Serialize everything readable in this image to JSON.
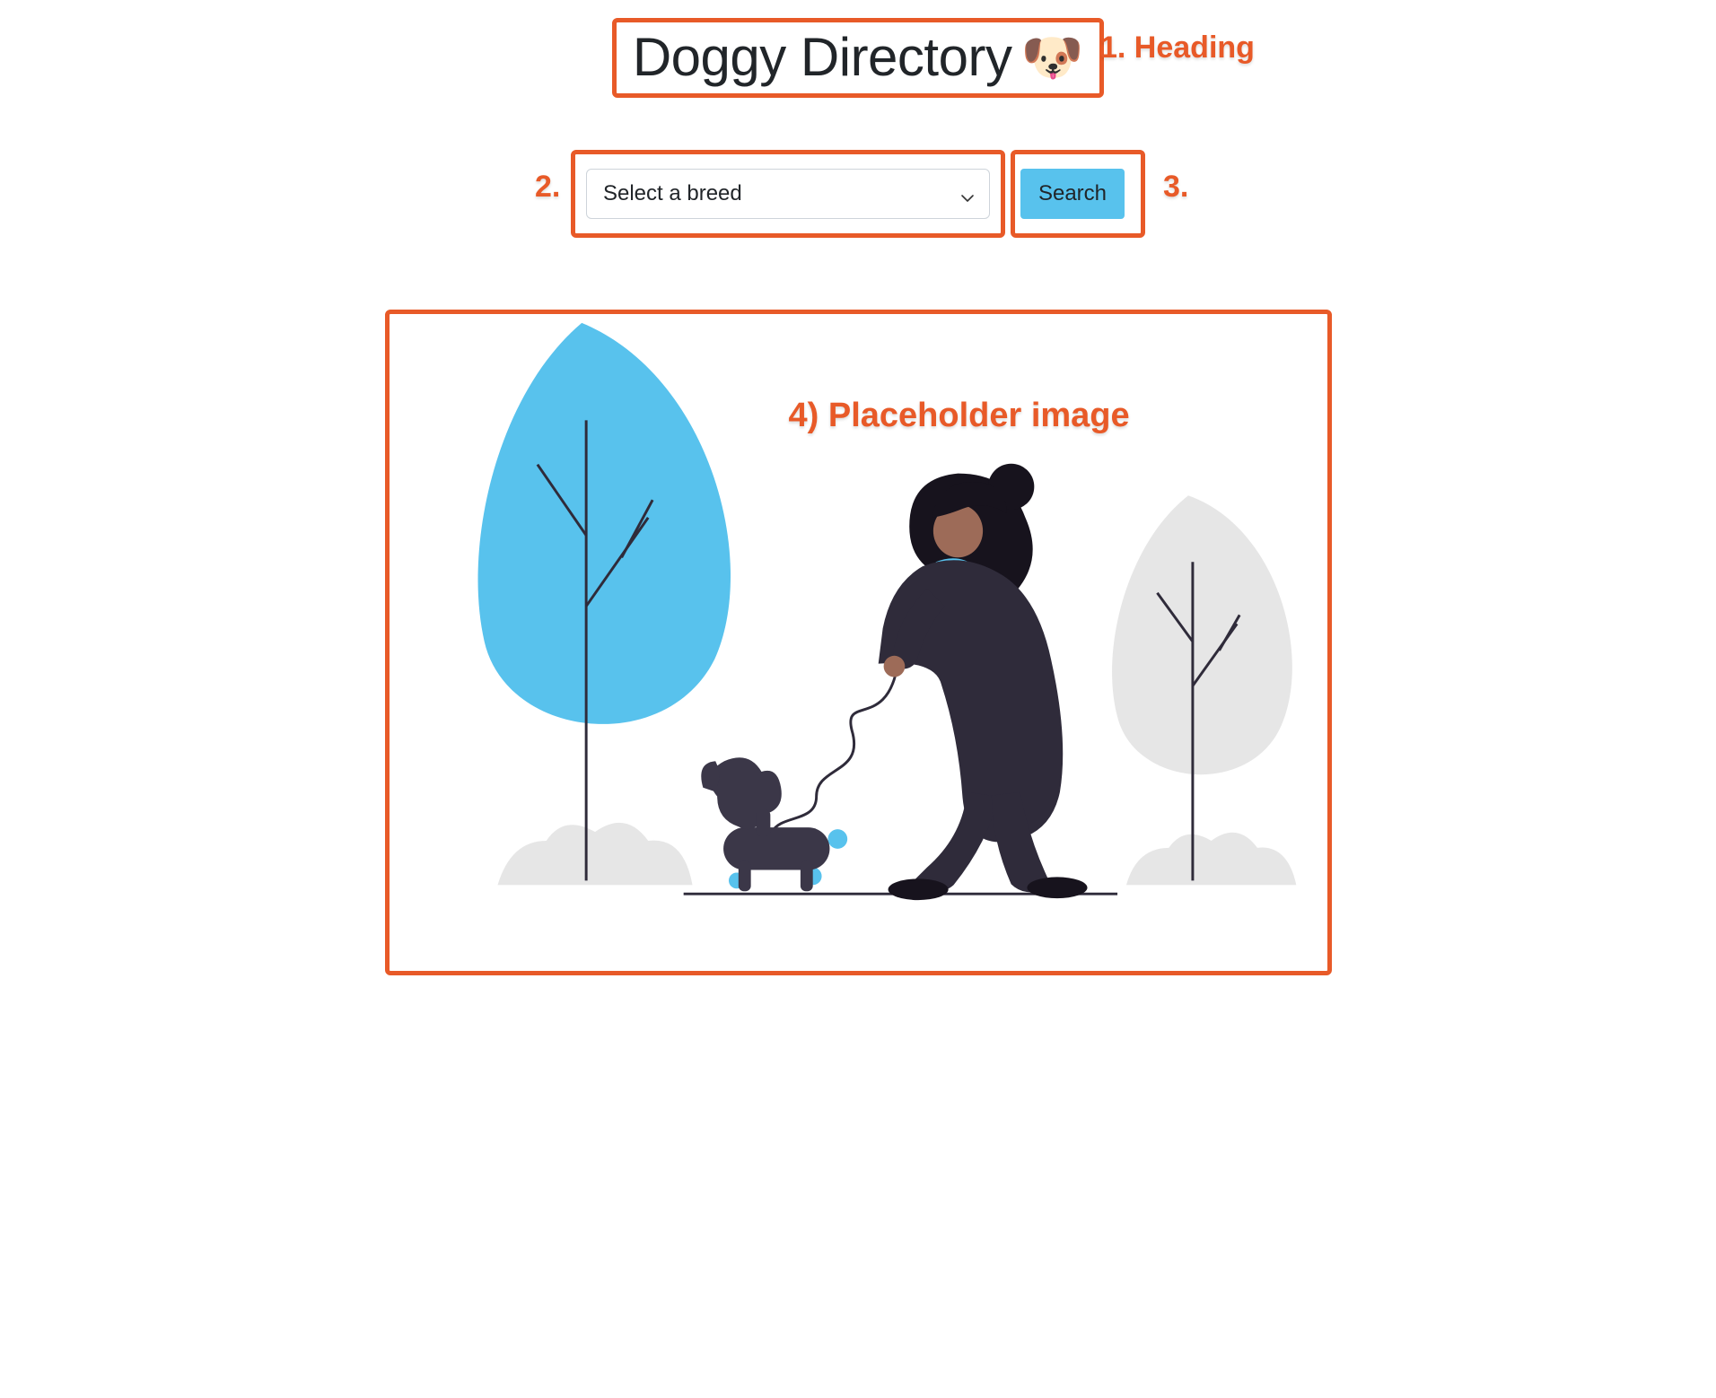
{
  "header": {
    "title": "Doggy Directory",
    "icon": "🐶"
  },
  "controls": {
    "select_placeholder": "Select a breed",
    "search_label": "Search"
  },
  "annotations": {
    "heading": "1. Heading",
    "select": "2.",
    "button": "3.",
    "placeholder": "4) Placeholder image"
  },
  "colors": {
    "annotation": "#e85a28",
    "accent": "#58c2ed",
    "tree_blue": "#58c2ed",
    "tree_grey": "#e6e6e6",
    "person_dark": "#2f2b3a",
    "skin": "#9d6b58"
  }
}
